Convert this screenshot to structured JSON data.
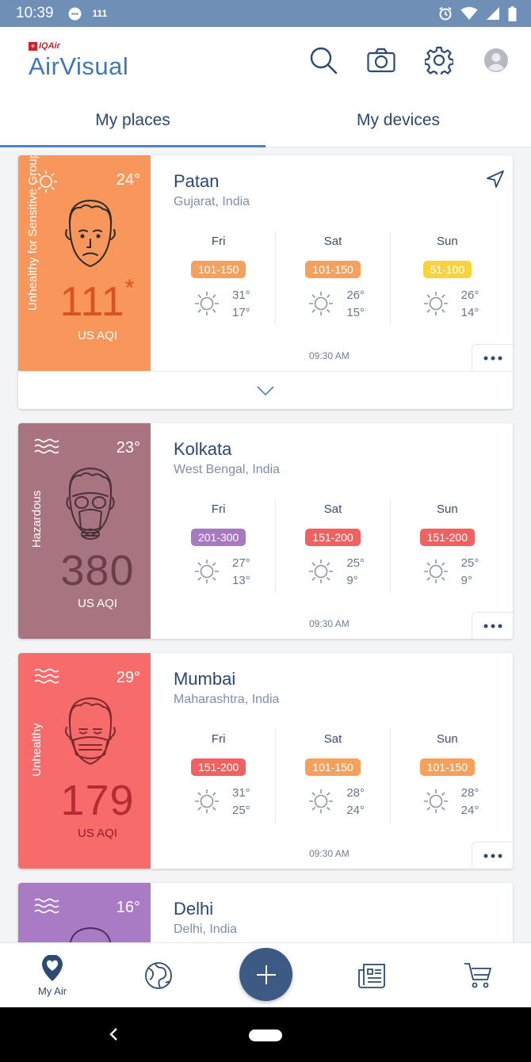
{
  "status_bar": {
    "time": "10:39",
    "notification_text": "111"
  },
  "brand": {
    "company": "IQAir",
    "product": "AirVisual"
  },
  "colors": {
    "usg": "#f9965b",
    "hazardous": "#a8747f",
    "unhealthy": "#f76b6b",
    "very_unhealthy": "#a97bc4",
    "badge_moderate": "#f7d33d",
    "badge_usg": "#f6a05e",
    "badge_unhealthy": "#f26161",
    "badge_very_unhealthy": "#a679c0",
    "accent": "#4d84c0",
    "fab": "#3d5a85"
  },
  "header_icons": [
    "search-icon",
    "camera-icon",
    "gear-icon",
    "avatar-icon"
  ],
  "tabs": [
    {
      "label": "My places"
    },
    {
      "label": "My devices"
    }
  ],
  "places": [
    {
      "city": "Patan",
      "region": "Gujarat, India",
      "temp": "24°",
      "condition_icon": "sun-icon",
      "face_icon": "sad-face-icon",
      "level": "Unhealthy for Sensitive Groups",
      "aqi": "111",
      "aqi_star": "*",
      "aqi_unit": "US AQI",
      "updated": "09:30 AM",
      "forecast": [
        {
          "day": "Fri",
          "range": "101-150",
          "high": "31°",
          "low": "17°"
        },
        {
          "day": "Sat",
          "range": "101-150",
          "high": "26°",
          "low": "15°"
        },
        {
          "day": "Sun",
          "range": "51-100",
          "high": "26°",
          "low": "14°"
        }
      ]
    },
    {
      "city": "Kolkata",
      "region": "West Bengal, India",
      "temp": "23°",
      "condition_icon": "haze-icon",
      "face_icon": "gas-mask-face-icon",
      "level": "Hazardous",
      "aqi": "380",
      "aqi_unit": "US AQI",
      "updated": "09:30 AM",
      "forecast": [
        {
          "day": "Fri",
          "range": "201-300",
          "high": "27°",
          "low": "13°"
        },
        {
          "day": "Sat",
          "range": "151-200",
          "high": "25°",
          "low": "9°"
        },
        {
          "day": "Sun",
          "range": "151-200",
          "high": "25°",
          "low": "9°"
        }
      ]
    },
    {
      "city": "Mumbai",
      "region": "Maharashtra, India",
      "temp": "29°",
      "condition_icon": "haze-icon",
      "face_icon": "mask-face-icon",
      "level": "Unhealthy",
      "aqi": "179",
      "aqi_unit": "US AQI",
      "updated": "09:30 AM",
      "forecast": [
        {
          "day": "Fri",
          "range": "151-200",
          "high": "31°",
          "low": "25°"
        },
        {
          "day": "Sat",
          "range": "101-150",
          "high": "28°",
          "low": "24°"
        },
        {
          "day": "Sun",
          "range": "101-150",
          "high": "28°",
          "low": "24°"
        }
      ]
    },
    {
      "city": "Delhi",
      "region": "Delhi, India",
      "temp": "16°",
      "condition_icon": "haze-icon"
    }
  ],
  "bottom_nav": {
    "my_air": "My Air"
  }
}
